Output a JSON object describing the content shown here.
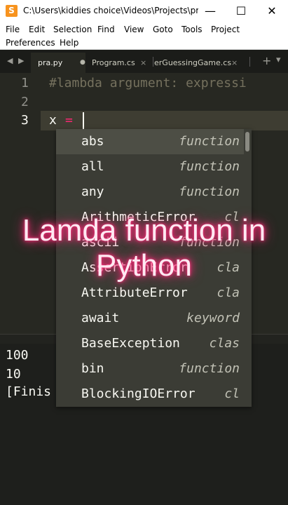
{
  "window": {
    "title": "C:\\Users\\kiddies choice\\Videos\\Projects\\pr...",
    "minimize": "—",
    "maximize": "☐",
    "close": "✕",
    "app_icon": "S"
  },
  "menu": [
    "File",
    "Edit",
    "Selection",
    "Find",
    "View",
    "Goto",
    "Tools",
    "Project",
    "Preferences",
    "Help"
  ],
  "tabs": {
    "nav_left": "◀",
    "nav_right": "▶",
    "items": [
      {
        "label": "pra.py",
        "marker": "●"
      },
      {
        "label": "Program.cs",
        "marker": "×"
      },
      {
        "label": "erGuessingGame.cs",
        "marker": "×"
      }
    ],
    "add": "+",
    "overflow": "▾"
  },
  "editor": {
    "line_numbers": [
      "1",
      "2",
      "3"
    ],
    "comment": "#lambda argument: expressi",
    "code_var": "x",
    "code_op": "="
  },
  "autocomplete": [
    {
      "name": "abs",
      "kind": "function"
    },
    {
      "name": "all",
      "kind": "function"
    },
    {
      "name": "any",
      "kind": "function"
    },
    {
      "name": "ArithmeticError",
      "kind": "cl"
    },
    {
      "name": "ascii",
      "kind": "function"
    },
    {
      "name": "AssertionError",
      "kind": "cla"
    },
    {
      "name": "AttributeError",
      "kind": "cla"
    },
    {
      "name": "await",
      "kind": "keyword"
    },
    {
      "name": "BaseException",
      "kind": "clas"
    },
    {
      "name": "bin",
      "kind": "function"
    },
    {
      "name": "BlockingIOError",
      "kind": "cl"
    }
  ],
  "output": [
    "100",
    "10",
    "[Finis"
  ],
  "overlay": {
    "line1": "Lamda function in",
    "line2": "Python"
  },
  "colors": {
    "background": "#272822",
    "keyword": "#f92672",
    "comment": "#75715e",
    "neon": "#ff2a78"
  }
}
